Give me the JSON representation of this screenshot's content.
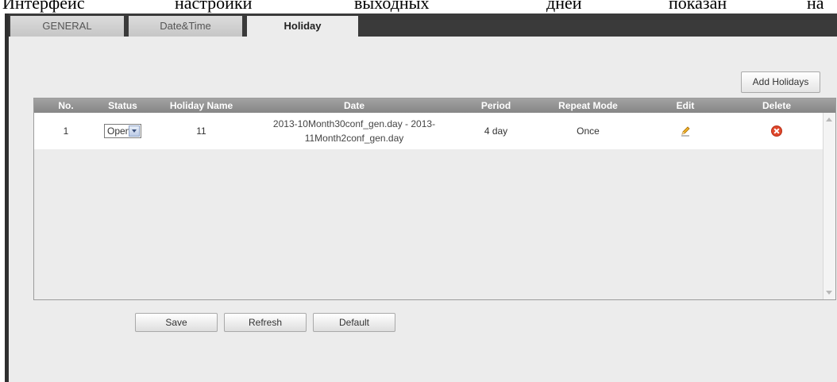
{
  "document_text": [
    "Интерфейс",
    "настройки",
    "выходных",
    "дней",
    "показан",
    "на"
  ],
  "tabs": [
    {
      "label": "GENERAL",
      "active": false
    },
    {
      "label": "Date&Time",
      "active": false
    },
    {
      "label": "Holiday",
      "active": true
    }
  ],
  "add_button_label": "Add Holidays",
  "table": {
    "columns": [
      "No.",
      "Status",
      "Holiday Name",
      "Date",
      "Period",
      "Repeat Mode",
      "Edit",
      "Delete"
    ],
    "rows": [
      {
        "no": "1",
        "status": "Open",
        "holiday_name": "11",
        "date_line1": "2013-10Month30conf_gen.day - 2013-",
        "date_line2": "11Month2conf_gen.day",
        "period": "4 day",
        "repeat_mode": "Once",
        "edit_icon": "pencil-icon",
        "delete_icon": "red-x-circle-icon"
      }
    ]
  },
  "buttons": {
    "save": "Save",
    "refresh": "Refresh",
    "default": "Default"
  },
  "colors": {
    "tab_bar": "#3a3a3a",
    "header_bg": "#999999",
    "panel_bg": "#ececec",
    "delete_red": "#e0472b"
  }
}
